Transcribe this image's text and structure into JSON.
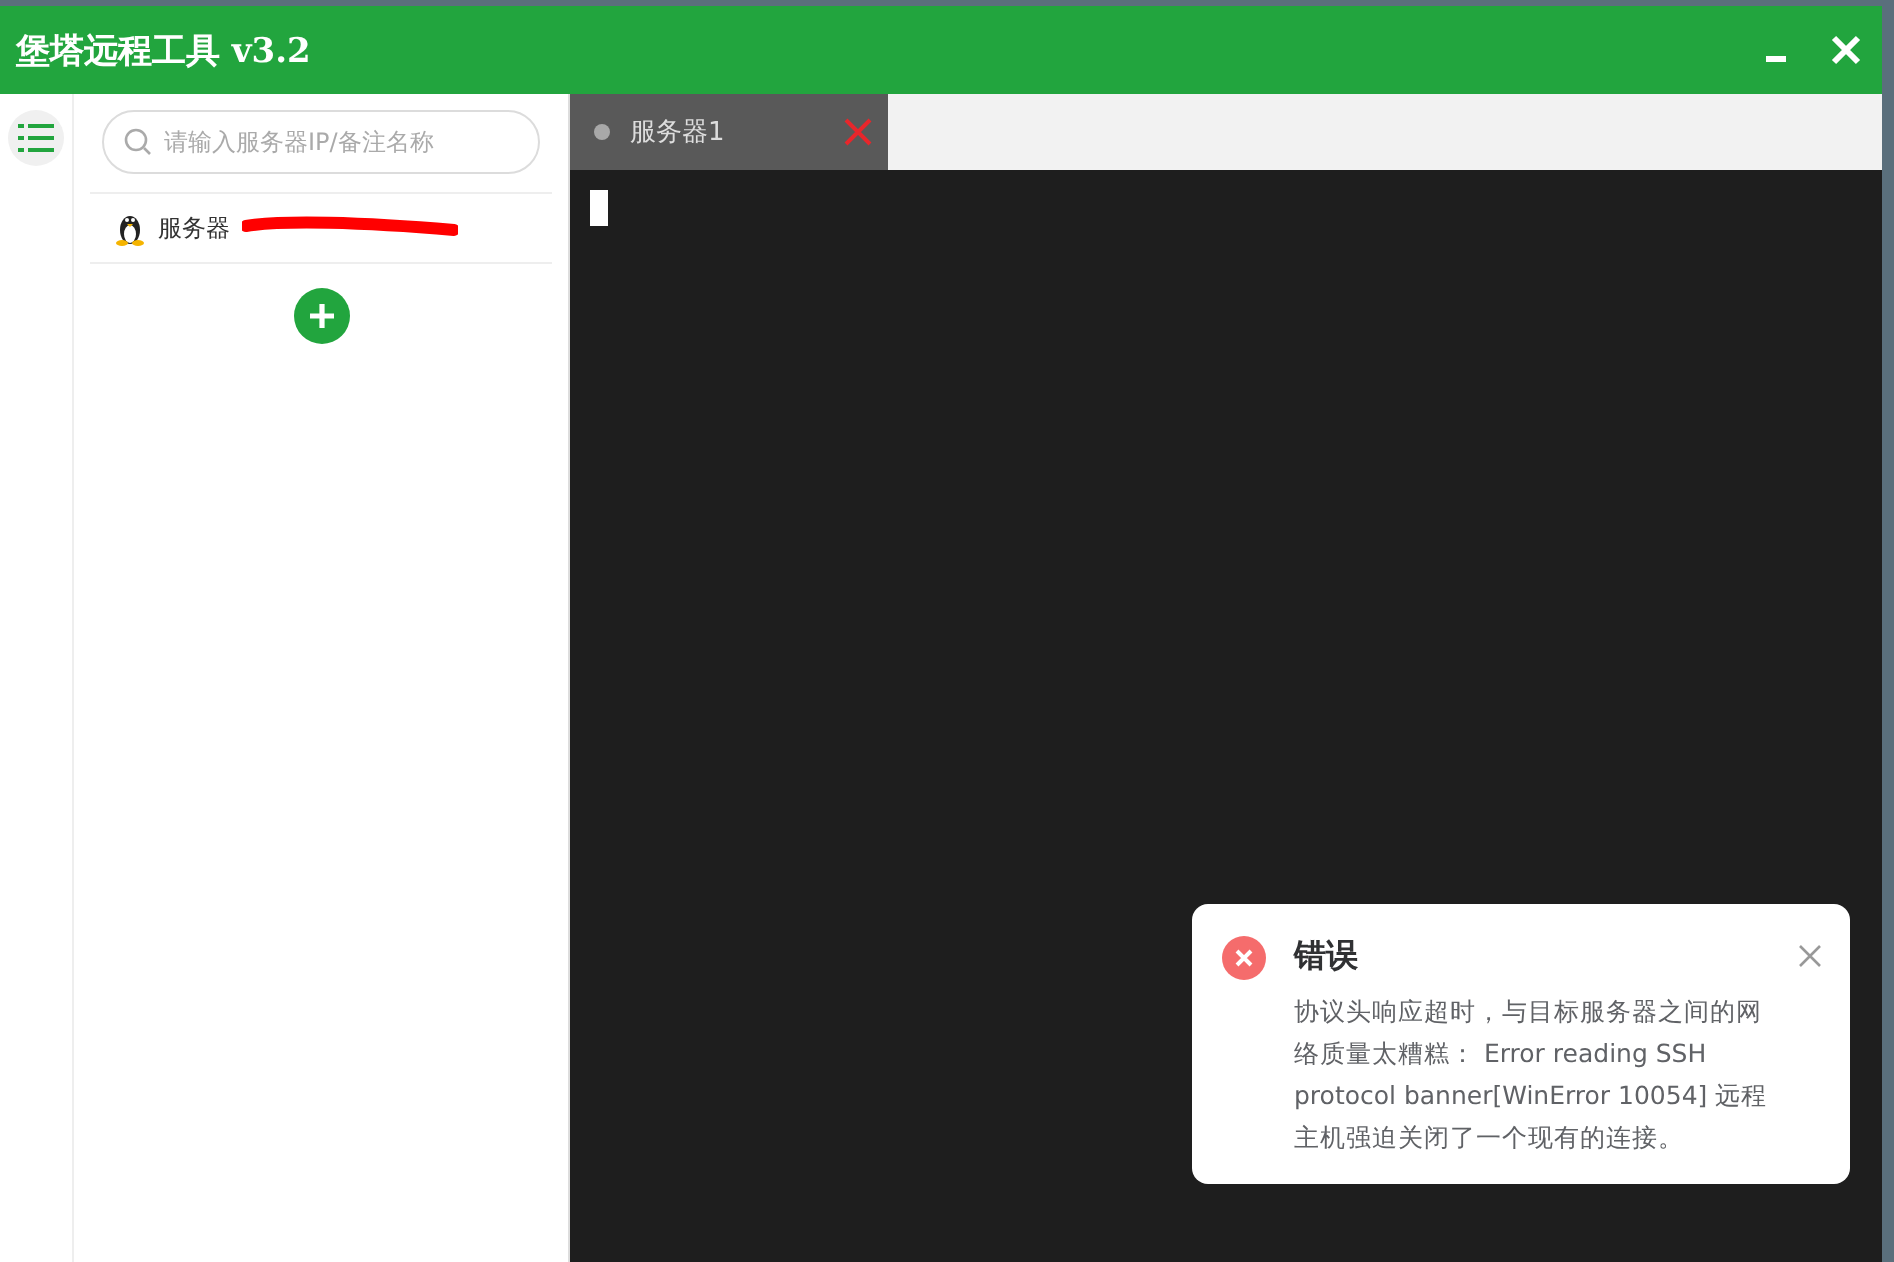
{
  "window": {
    "title": "堡塔远程工具 v3.2"
  },
  "search": {
    "placeholder": "请输入服务器IP/备注名称"
  },
  "servers": [
    {
      "name": "服务器",
      "redacted": true
    }
  ],
  "tabs": [
    {
      "label": "服务器1",
      "selected": true
    }
  ],
  "notification": {
    "kind": "error",
    "title": "错误",
    "message": "协议头响应超时，与目标服务器之间的网络质量太糟糕： Error reading SSH protocol banner[WinError 10054] 远程主机强迫关闭了一个现有的连接。"
  }
}
